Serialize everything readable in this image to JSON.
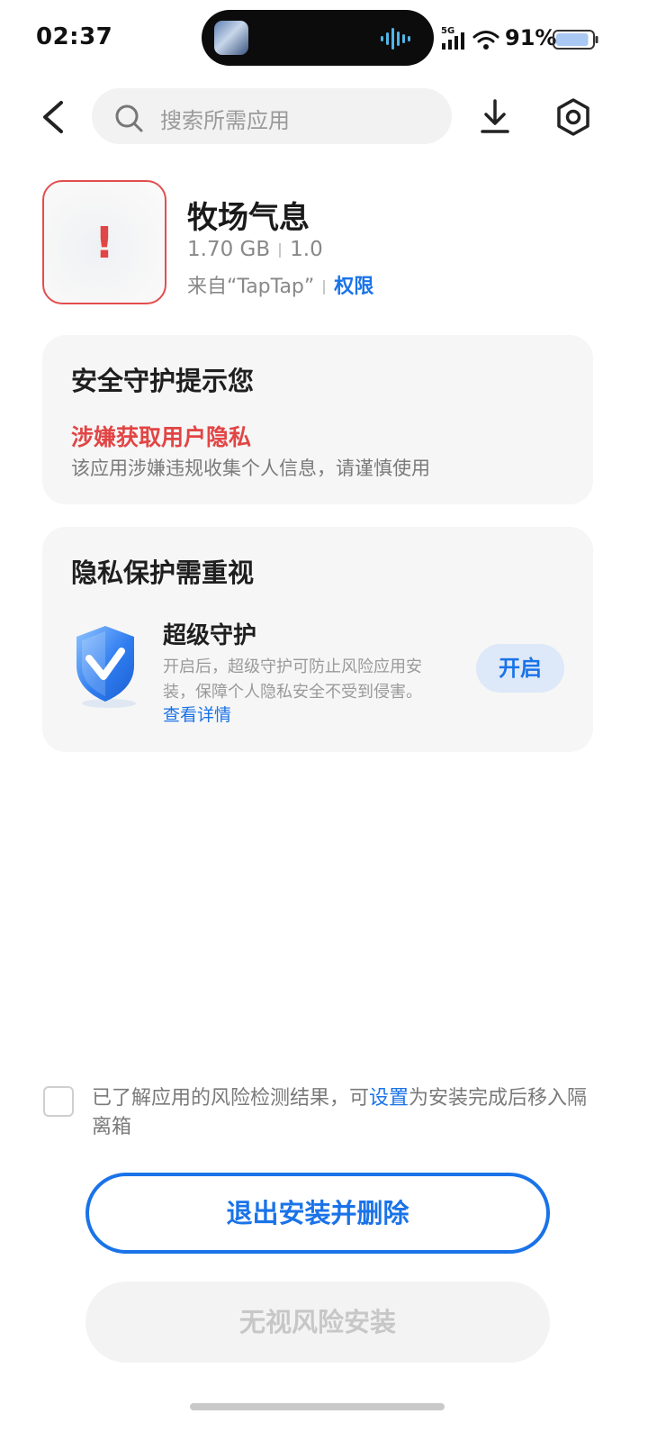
{
  "status_bar": {
    "time": "02:37",
    "network": "5G",
    "battery_percent": "91%",
    "battery_level": 0.91
  },
  "top_bar": {
    "search_placeholder": "搜索所需应用",
    "icons": [
      "back-arrow-icon",
      "search-icon",
      "download-icon",
      "settings-hexagon-icon"
    ]
  },
  "app": {
    "name": "牧场气息",
    "size": "1.70 GB",
    "version": "1.0",
    "source": "来自“TapTap”",
    "permissions_label": "权限"
  },
  "security_card": {
    "title": "安全守护提示您",
    "risk_title": "涉嫌获取用户隐私",
    "risk_desc": "该应用涉嫌违规收集个人信息，请谨慎使用"
  },
  "privacy_card": {
    "title": "隐私保护需重视",
    "guard_title": "超级守护",
    "guard_desc": "开启后，超级守护可防止风险应用安装，保障个人隐私安全不受到侵害。",
    "detail_link": "查看详情",
    "enable_label": "开启"
  },
  "acknowledge": {
    "text_before": "已了解应用的风险检测结果，可",
    "link": "设置",
    "text_after": "为安装完成后移入隔离箱",
    "checked": false
  },
  "buttons": {
    "exit": "退出安装并删除",
    "ignore": "无视风险安装"
  },
  "colors": {
    "accent": "#1a73e8",
    "danger": "#e24545",
    "card_bg": "#f6f6f6"
  }
}
